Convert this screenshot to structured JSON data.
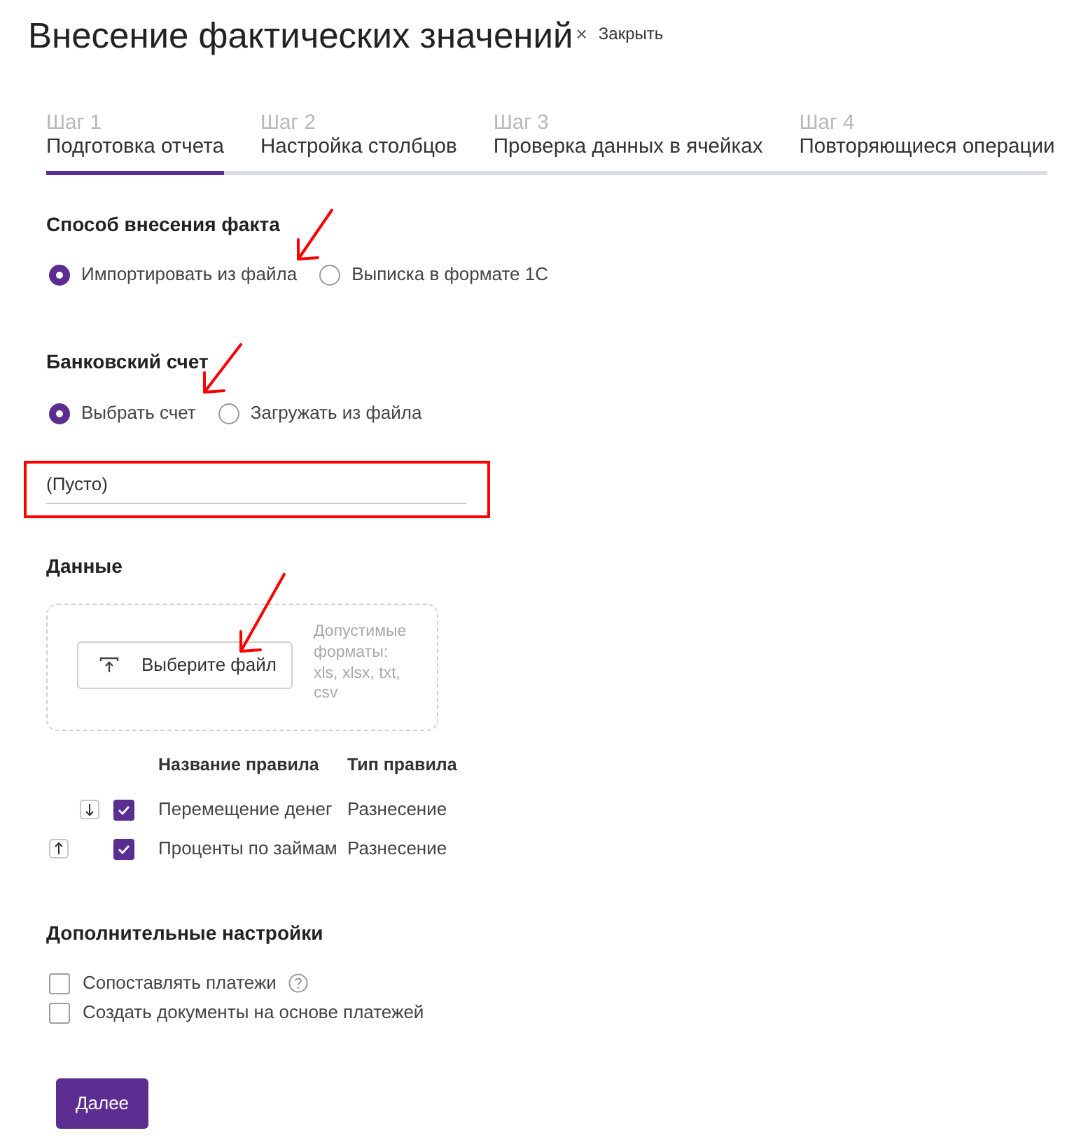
{
  "dialog": {
    "title": "Внесение фактических значений",
    "close": {
      "icon": "×",
      "label": "Закрыть"
    }
  },
  "steps": [
    {
      "number": "Шаг 1",
      "label": "Подготовка отчета",
      "selected": true
    },
    {
      "number": "Шаг 2",
      "label": "Настройка столбцов",
      "selected": false
    },
    {
      "number": "Шаг 3",
      "label": "Проверка данных в ячейках",
      "selected": false
    },
    {
      "number": "Шаг 4",
      "label": "Повторяющиеся операции",
      "selected": false
    }
  ],
  "input_method": {
    "title": "Способ внесения факта",
    "options": [
      {
        "label": "Импортировать из файла",
        "selected": true
      },
      {
        "label": "Выписка в формате 1С",
        "selected": false
      }
    ]
  },
  "bank_account": {
    "title": "Банковский счет",
    "options": [
      {
        "label": "Выбрать счет",
        "selected": true
      },
      {
        "label": "Загружать из файла",
        "selected": false
      }
    ],
    "field": {
      "value": "(Пусто)"
    }
  },
  "data": {
    "title": "Данные",
    "upload_button": "Выберите файл",
    "hint": "Допустимые форматы: xls, xlsx, txt, csv"
  },
  "rules": {
    "columns": [
      "Название правила",
      "Тип правила"
    ],
    "rows": [
      {
        "kind": "down",
        "checked": true,
        "name": "Перемещение денег",
        "type": "Разнесение"
      },
      {
        "kind": "up",
        "checked": true,
        "name": "Проценты по займам",
        "type": "Разнесение"
      }
    ]
  },
  "extra": {
    "title": "Дополнительные настройки",
    "options": [
      {
        "label": "Сопоставлять платежи",
        "checked": false,
        "help": true
      },
      {
        "label": "Создать документы на основе платежей",
        "checked": false,
        "help": false
      }
    ]
  },
  "next_button": "Далее"
}
